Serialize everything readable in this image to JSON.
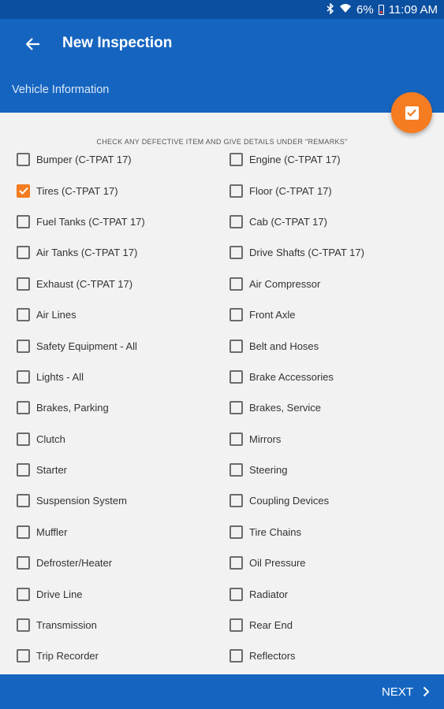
{
  "status_bar": {
    "battery_text": "6%",
    "time": "11:09 AM"
  },
  "header": {
    "back_icon": "arrow-left-icon",
    "title": "New Inspection",
    "subtitle": "Vehicle Information"
  },
  "fab": {
    "icon": "checkbox-icon",
    "color": "#f57c20"
  },
  "colors": {
    "primary": "#1565c0",
    "accent": "#f57c20",
    "status_bar": "#0b4fa0"
  },
  "instructions": "CHECK ANY DEFECTIVE ITEM AND GIVE DETAILS UNDER \"REMARKS\"",
  "checklist": {
    "left": [
      {
        "label": "Bumper (C-TPAT 17)",
        "checked": false
      },
      {
        "label": "Tires (C-TPAT 17)",
        "checked": true
      },
      {
        "label": "Fuel Tanks (C-TPAT 17)",
        "checked": false
      },
      {
        "label": "Air Tanks (C-TPAT 17)",
        "checked": false
      },
      {
        "label": "Exhaust (C-TPAT 17)",
        "checked": false
      },
      {
        "label": "Air Lines",
        "checked": false
      },
      {
        "label": "Safety Equipment - All",
        "checked": false
      },
      {
        "label": "Lights - All",
        "checked": false
      },
      {
        "label": "Brakes, Parking",
        "checked": false
      },
      {
        "label": "Clutch",
        "checked": false
      },
      {
        "label": "Starter",
        "checked": false
      },
      {
        "label": "Suspension System",
        "checked": false
      },
      {
        "label": "Muffler",
        "checked": false
      },
      {
        "label": "Defroster/Heater",
        "checked": false
      },
      {
        "label": "Drive Line",
        "checked": false
      },
      {
        "label": "Transmission",
        "checked": false
      },
      {
        "label": "Trip Recorder",
        "checked": false
      }
    ],
    "right": [
      {
        "label": "Engine (C-TPAT 17)",
        "checked": false
      },
      {
        "label": "Floor (C-TPAT 17)",
        "checked": false
      },
      {
        "label": "Cab (C-TPAT 17)",
        "checked": false
      },
      {
        "label": "Drive Shafts (C-TPAT 17)",
        "checked": false
      },
      {
        "label": "Air Compressor",
        "checked": false
      },
      {
        "label": "Front Axle",
        "checked": false
      },
      {
        "label": "Belt and Hoses",
        "checked": false
      },
      {
        "label": "Brake Accessories",
        "checked": false
      },
      {
        "label": "Brakes, Service",
        "checked": false
      },
      {
        "label": "Mirrors",
        "checked": false
      },
      {
        "label": "Steering",
        "checked": false
      },
      {
        "label": "Coupling Devices",
        "checked": false
      },
      {
        "label": "Tire Chains",
        "checked": false
      },
      {
        "label": "Oil Pressure",
        "checked": false
      },
      {
        "label": "Radiator",
        "checked": false
      },
      {
        "label": "Rear End",
        "checked": false
      },
      {
        "label": "Reflectors",
        "checked": false
      }
    ]
  },
  "footer": {
    "next_label": "NEXT",
    "next_icon": "chevron-right-icon"
  }
}
